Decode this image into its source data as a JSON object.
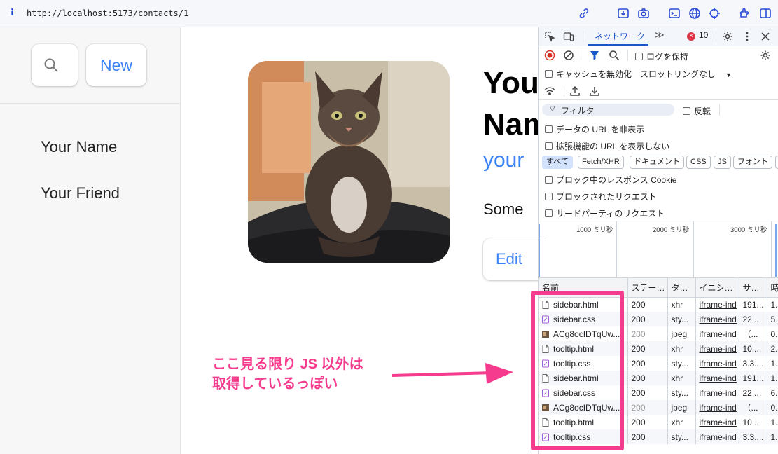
{
  "address_bar": {
    "info": "i",
    "url": "http://localhost:5173/contacts/1"
  },
  "sidebar": {
    "new_label": "New",
    "contacts": [
      "Your Name",
      "Your Friend"
    ]
  },
  "contact": {
    "name_line1": "You",
    "name_line2": "Nam",
    "handle": "your",
    "notes": "Some",
    "edit_label": "Edit"
  },
  "annotation": {
    "line1": "ここ見る限り JS 以外は",
    "line2": "取得しているっぽい",
    "color": "#f53b8d"
  },
  "devtools": {
    "tabs": {
      "network": "ネットワーク",
      "more": "≫",
      "error_count": "10"
    },
    "toolbar": {
      "preserve_log": "ログを保持",
      "disable_cache": "キャッシュを無効化",
      "throttling": "スロットリングなし"
    },
    "filter": {
      "placeholder": "フィルタ",
      "invert": "反転"
    },
    "options": {
      "hide_data_urls": "データの URL を非表示",
      "hide_extension_urls": "拡張機能の URL を表示しない",
      "blocked_cookies": "ブロック中のレスポンス Cookie",
      "blocked_requests": "ブロックされたリクエスト",
      "third_party": "サードパーティのリクエスト"
    },
    "type_chips": [
      "すべて",
      "Fetch/XHR",
      "ドキュメント",
      "CSS",
      "JS",
      "フォント"
    ],
    "timeline_ticks": [
      "1000 ミリ秒",
      "2000 ミリ秒",
      "3000 ミリ秒"
    ],
    "columns": [
      "名前",
      "ステー…",
      "タ…",
      "イニシ…",
      "サ…",
      "時"
    ],
    "rows": [
      {
        "icon": "doc",
        "name": "sidebar.html",
        "status": "200",
        "type": "xhr",
        "initiator": "iframe-ind",
        "size": "191...",
        "time": "1..."
      },
      {
        "icon": "css",
        "name": "sidebar.css",
        "status": "200",
        "type": "sty...",
        "initiator": "iframe-ind",
        "size": "22....",
        "time": "5..."
      },
      {
        "icon": "img",
        "name": "ACg8ocIDTqUw...",
        "status": "200",
        "type": "jpeg",
        "initiator": "iframe-ind",
        "size": "（...",
        "time": "0..."
      },
      {
        "icon": "doc",
        "name": "tooltip.html",
        "status": "200",
        "type": "xhr",
        "initiator": "iframe-ind",
        "size": "10....",
        "time": "2..."
      },
      {
        "icon": "css",
        "name": "tooltip.css",
        "status": "200",
        "type": "sty...",
        "initiator": "iframe-ind",
        "size": "3.3....",
        "time": "1..."
      },
      {
        "icon": "doc",
        "name": "sidebar.html",
        "status": "200",
        "type": "xhr",
        "initiator": "iframe-ind",
        "size": "191...",
        "time": "1..."
      },
      {
        "icon": "css",
        "name": "sidebar.css",
        "status": "200",
        "type": "sty...",
        "initiator": "iframe-ind",
        "size": "22....",
        "time": "6..."
      },
      {
        "icon": "img",
        "name": "ACg8ocIDTqUw...",
        "status": "200",
        "type": "jpeg",
        "initiator": "iframe-ind",
        "size": "（...",
        "time": "0..."
      },
      {
        "icon": "doc",
        "name": "tooltip.html",
        "status": "200",
        "type": "xhr",
        "initiator": "iframe-ind",
        "size": "10....",
        "time": "1..."
      },
      {
        "icon": "css",
        "name": "tooltip.css",
        "status": "200",
        "type": "sty...",
        "initiator": "iframe-ind",
        "size": "3.3....",
        "time": "1..."
      }
    ]
  }
}
